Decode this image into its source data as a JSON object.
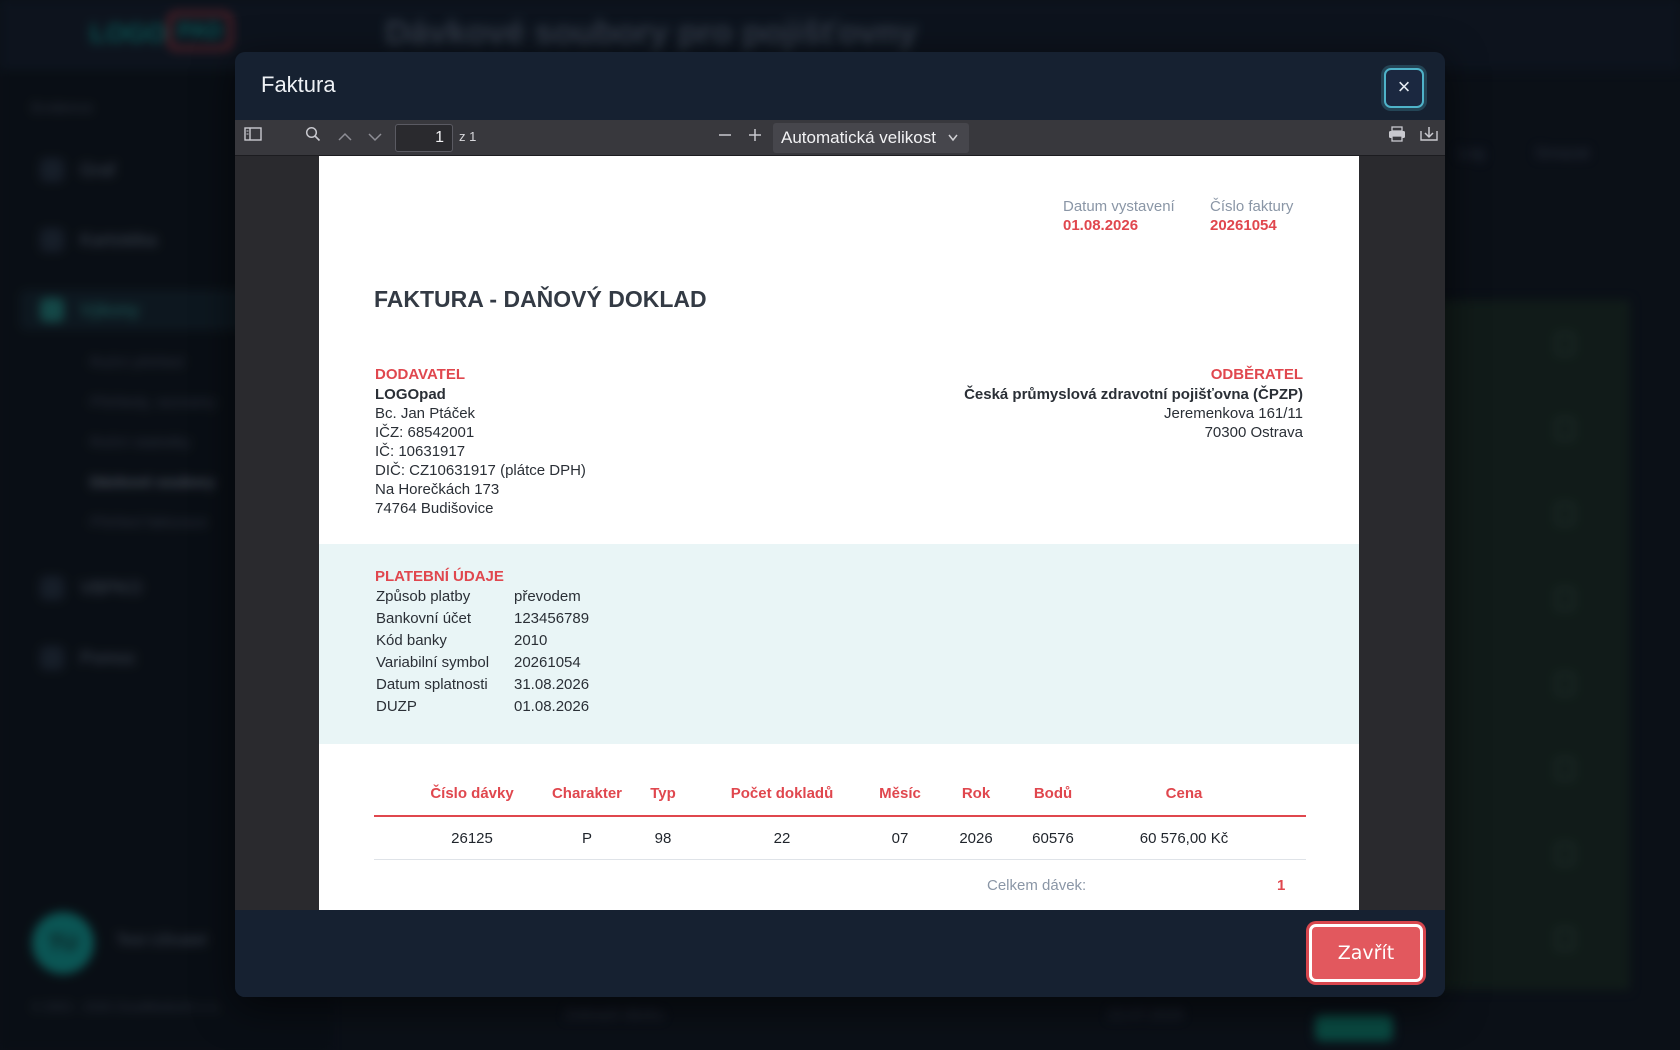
{
  "background": {
    "logo_text": "LOGO",
    "logo_pad": "PAD",
    "page_title": "Dávkové soubory pro pojišťovny",
    "sidebar_label": "Evidence",
    "nav": [
      {
        "label": "Graf"
      },
      {
        "label": "Kartotéka"
      },
      {
        "label": "Výkony"
      },
      {
        "label": "VBPKO"
      },
      {
        "label": "Pomoc"
      }
    ],
    "subnav": [
      "Ruční přehled",
      "Přehledy, seznamy",
      "Roční statistiky",
      "Dávkové soubory",
      "Přehled fakturace"
    ],
    "user_initials": "TU",
    "user_name": "Test Uživatel",
    "footer": "© 2003 – 2026 CloudMedisoft s.r.o.",
    "col_a": "Log",
    "col_b": "Smazat",
    "row_texts": [
      "Zobrazit dávku",
      "22.07.2026"
    ]
  },
  "modal": {
    "title": "Faktura",
    "close_icon": "×",
    "close_button": "Zavřít"
  },
  "viewer": {
    "page_number": "1",
    "page_of": "z 1",
    "zoom": "Automatická velikost",
    "icons": {
      "sidebar": "sidebar-toggle-icon",
      "search": "search-icon",
      "prev": "chevron-up-icon",
      "next": "chevron-down-icon",
      "zoom_out": "minus-icon",
      "zoom_in": "plus-icon",
      "print": "print-icon",
      "download": "download-icon"
    }
  },
  "invoice": {
    "issue_date_label": "Datum vystavení",
    "issue_date": "01.08.2026",
    "number_label": "Číslo faktury",
    "number": "20261054",
    "title": "FAKTURA - DAŇOVÝ DOKLAD",
    "supplier_label": "DODAVATEL",
    "supplier": [
      "LOGOpad",
      "Bc. Jan Ptáček",
      "IČZ: 68542001",
      "IČ: 10631917",
      "DIČ: CZ10631917 (plátce DPH)",
      "Na Horečkách 173",
      "74764 Budišovice"
    ],
    "customer_label": "ODBĚRATEL",
    "customer": [
      "Česká průmyslová zdravotní pojišťovna (ČPZP)",
      "Jeremenkova 161/11",
      "70300 Ostrava"
    ],
    "payment_label": "PLATEBNÍ ÚDAJE",
    "payment": [
      {
        "key": "Způsob platby",
        "value": "převodem"
      },
      {
        "key": "Bankovní účet",
        "value": "123456789"
      },
      {
        "key": "Kód banky",
        "value": "2010"
      },
      {
        "key": "Variabilní symbol",
        "value": "20261054"
      },
      {
        "key": "Datum splatnosti",
        "value": "31.08.2026"
      },
      {
        "key": "DUZP",
        "value": "01.08.2026"
      }
    ],
    "table_headers": [
      "Číslo dávky",
      "Charakter",
      "Typ",
      "Počet dokladů",
      "Měsíc",
      "Rok",
      "Bodů",
      "Cena"
    ],
    "table_rows": [
      [
        "26125",
        "P",
        "98",
        "22",
        "07",
        "2026",
        "60576",
        "60 576,00 Kč"
      ]
    ],
    "total_label": "Celkem dávek:",
    "total_value": "1"
  },
  "colors": {
    "accent_red": "#e0474e",
    "modal_bg": "#162131",
    "focus_ring": "#4fb3c9"
  }
}
